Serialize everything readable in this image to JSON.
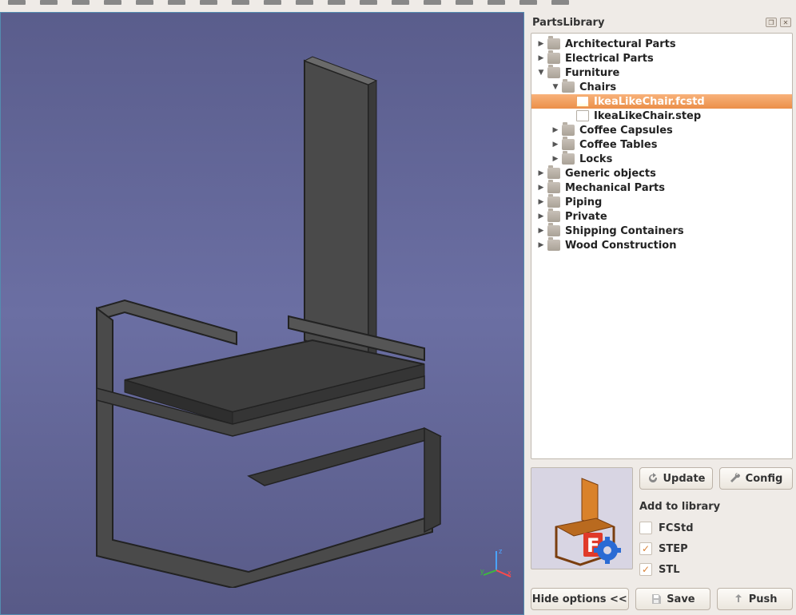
{
  "panel": {
    "title": "PartsLibrary"
  },
  "tree": {
    "items": [
      {
        "label": "Architectural Parts",
        "indent": 0,
        "state": "closed",
        "type": "folder",
        "selected": false
      },
      {
        "label": "Electrical Parts",
        "indent": 0,
        "state": "closed",
        "type": "folder",
        "selected": false
      },
      {
        "label": "Furniture",
        "indent": 0,
        "state": "open",
        "type": "folder",
        "selected": false
      },
      {
        "label": "Chairs",
        "indent": 1,
        "state": "open",
        "type": "folder",
        "selected": false
      },
      {
        "label": "IkeaLikeChair.fcstd",
        "indent": 2,
        "state": "none",
        "type": "file-fc",
        "selected": true
      },
      {
        "label": "IkeaLikeChair.step",
        "indent": 2,
        "state": "none",
        "type": "file",
        "selected": false
      },
      {
        "label": "Coffee Capsules",
        "indent": 1,
        "state": "closed",
        "type": "folder",
        "selected": false
      },
      {
        "label": "Coffee Tables",
        "indent": 1,
        "state": "closed",
        "type": "folder",
        "selected": false
      },
      {
        "label": "Locks",
        "indent": 1,
        "state": "closed",
        "type": "folder",
        "selected": false
      },
      {
        "label": "Generic objects",
        "indent": 0,
        "state": "closed",
        "type": "folder",
        "selected": false
      },
      {
        "label": "Mechanical Parts",
        "indent": 0,
        "state": "closed",
        "type": "folder",
        "selected": false
      },
      {
        "label": "Piping",
        "indent": 0,
        "state": "closed",
        "type": "folder",
        "selected": false
      },
      {
        "label": "Private",
        "indent": 0,
        "state": "closed",
        "type": "folder",
        "selected": false
      },
      {
        "label": "Shipping Containers",
        "indent": 0,
        "state": "closed",
        "type": "folder",
        "selected": false
      },
      {
        "label": "Wood Construction",
        "indent": 0,
        "state": "closed",
        "type": "folder",
        "selected": false
      }
    ]
  },
  "buttons": {
    "update": "Update",
    "config": "Config",
    "hide_options": "Hide options <<",
    "save": "Save",
    "push": "Push"
  },
  "addlib": {
    "title": "Add to library",
    "fcstd_label": "FCStd",
    "step_label": "STEP",
    "stl_label": "STL",
    "fcstd_checked": false,
    "step_checked": true,
    "stl_checked": true
  },
  "axis": {
    "x": "x",
    "y": "y",
    "z": "z"
  }
}
